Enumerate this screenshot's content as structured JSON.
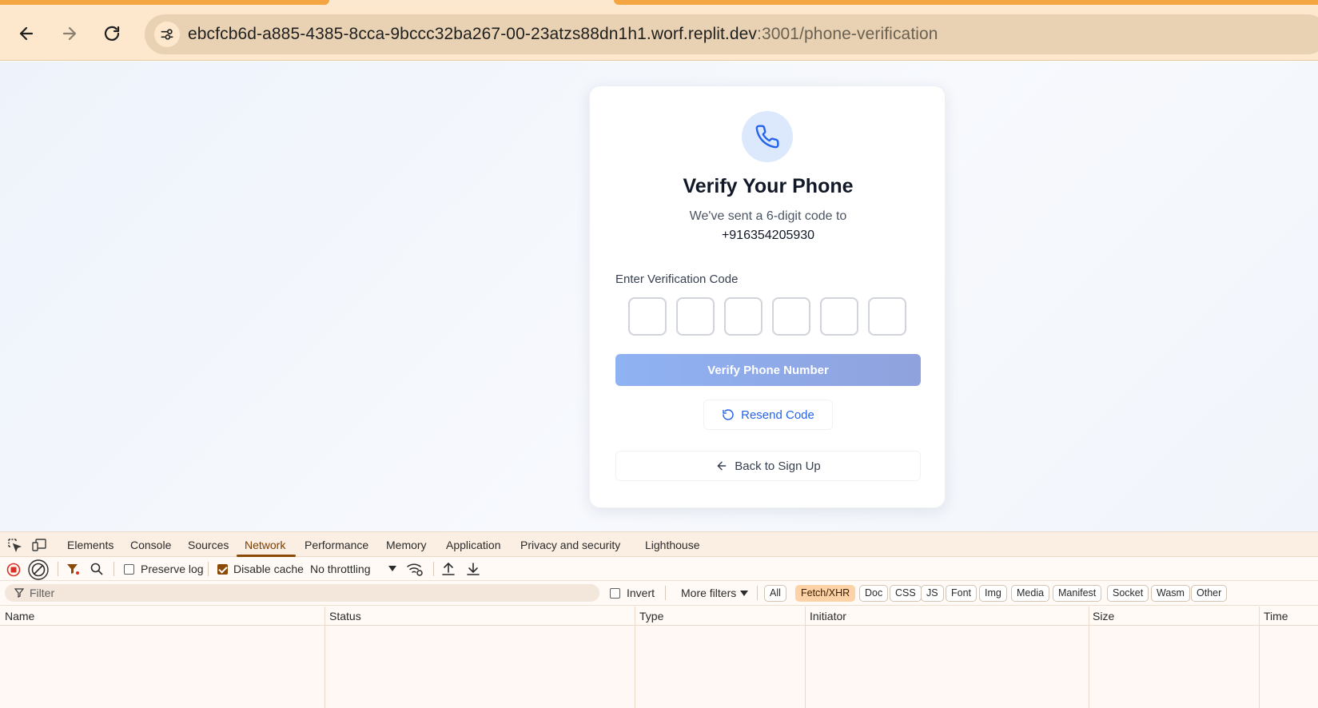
{
  "browser": {
    "url_host": "ebcfcb6d-a885-4385-8cca-9bccc32ba267-00-23atzs88dn1h1.worf.replit.dev",
    "url_rest": ":3001/phone-verification"
  },
  "card": {
    "title": "Verify Your Phone",
    "subtitle": "We've sent a 6-digit code to",
    "phone": "+916354205930",
    "code_label": "Enter Verification Code",
    "otp_digits": [
      "",
      "",
      "",
      "",
      "",
      ""
    ],
    "verify_label": "Verify Phone Number",
    "resend_label": "Resend Code",
    "back_label": "Back to Sign Up"
  },
  "devtools": {
    "tabs": [
      "Elements",
      "Console",
      "Sources",
      "Network",
      "Performance",
      "Memory",
      "Application",
      "Privacy and security",
      "Lighthouse"
    ],
    "active_tab": "Network",
    "preserve_log": "Preserve log",
    "disable_cache": "Disable cache",
    "throttling": "No throttling",
    "filter_placeholder": "Filter",
    "invert": "Invert",
    "more_filters": "More filters",
    "type_filters": [
      "All",
      "Fetch/XHR",
      "Doc",
      "CSS",
      "JS",
      "Font",
      "Img",
      "Media",
      "Manifest",
      "Socket",
      "Wasm",
      "Other"
    ],
    "active_filter": "Fetch/XHR",
    "columns": [
      "Name",
      "Status",
      "Type",
      "Initiator",
      "Size",
      "Time"
    ]
  },
  "colors": {
    "chrome": "#fde8cd",
    "accent": "#2563eb",
    "devtools_accent": "#8a4a06"
  }
}
